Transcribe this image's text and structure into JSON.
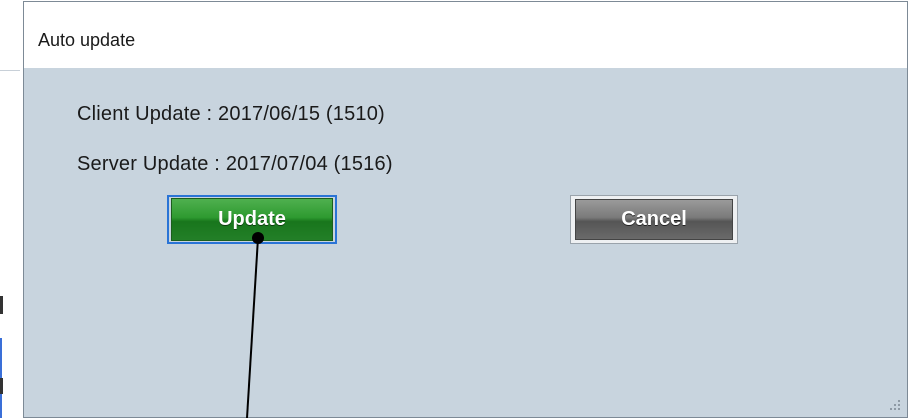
{
  "dialog": {
    "title": "Auto update",
    "client_update": "Client Update : 2017/06/15 (1510)",
    "server_update": "Server Update : 2017/07/04 (1516)",
    "update_label": "Update",
    "cancel_label": "Cancel"
  },
  "colors": {
    "dialog_bg": "#c8d4de",
    "update_button": "#2e9a30",
    "cancel_button": "#7a7a7a",
    "focus_ring": "#2a74d6"
  },
  "icons": {
    "resize_grip": "resize-grip-icon",
    "callout": "callout-pointer"
  }
}
